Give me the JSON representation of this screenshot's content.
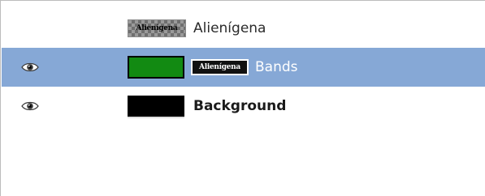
{
  "layers": [
    {
      "name": "Alienígena",
      "visible": false,
      "selected": false,
      "bold": false,
      "thumbnail_text": "Alienígena",
      "thumbnail_kind": "text-layer-checker"
    },
    {
      "name": "Bands",
      "visible": true,
      "selected": true,
      "bold": false,
      "thumbnail_color": "#128a12",
      "mask_text": "Alienígena"
    },
    {
      "name": "Background",
      "visible": true,
      "selected": false,
      "bold": true,
      "thumbnail_color": "#000000"
    }
  ],
  "colors": {
    "selection": "#86a8d6",
    "green_fill": "#128a12",
    "black_fill": "#000000"
  },
  "icons": {
    "visibility": "eye-icon"
  }
}
